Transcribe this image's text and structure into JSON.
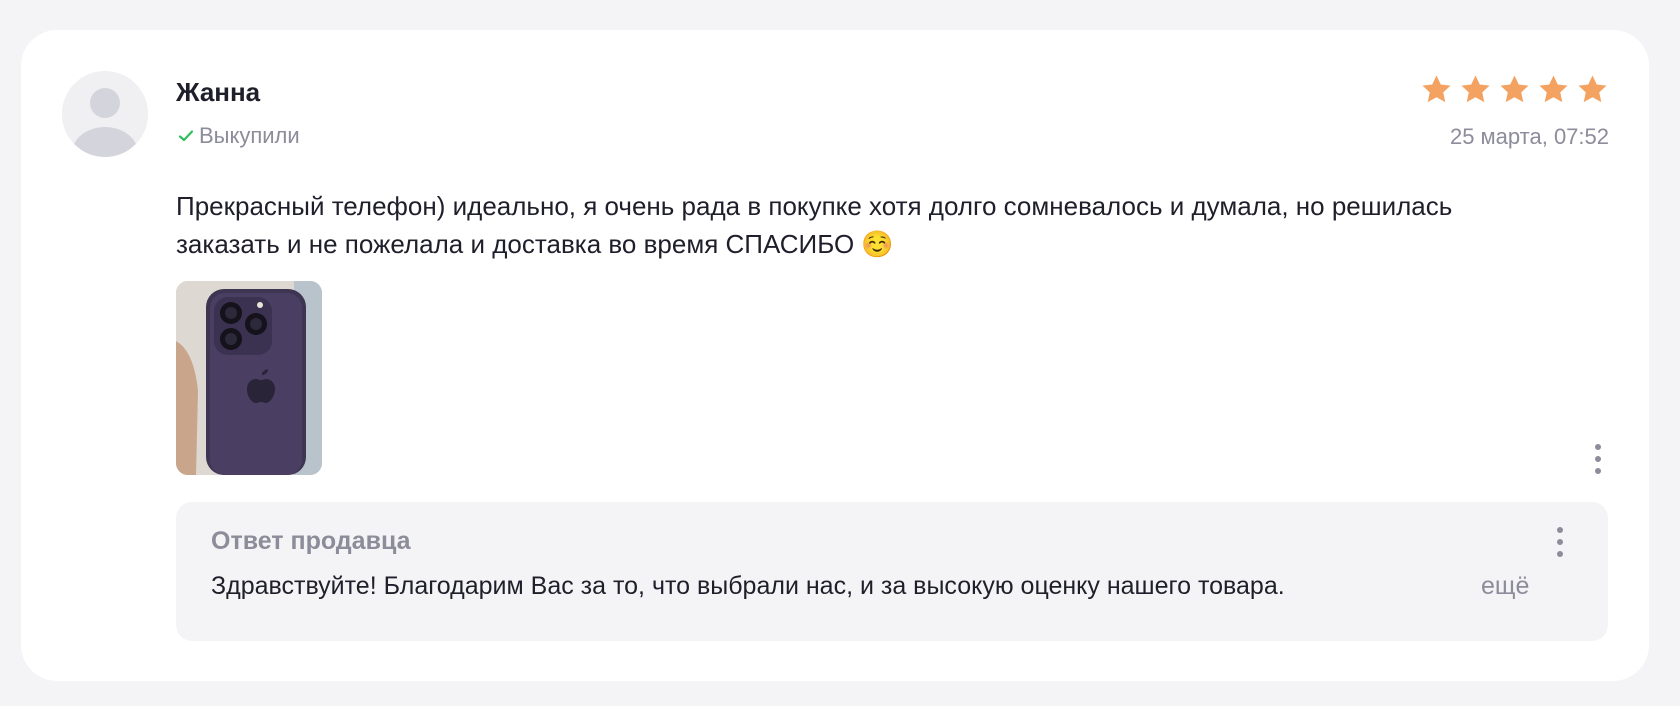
{
  "review": {
    "author": "Жанна",
    "purchase_status": "Выкупили",
    "rating": 5,
    "rating_max": 5,
    "date": "25 марта, 07:52",
    "text": "Прекрасный телефон) идеально, я очень рада в покупке хотя долго сомневалось и думала, но решилась заказать и не пожелала и доставка во время СПАСИБО ☺️",
    "photos": [
      "phone-photo"
    ],
    "icons": {
      "avatar": "user-avatar-icon",
      "check": "check-icon",
      "star": "star-icon",
      "more": "more-vertical-icon"
    },
    "colors": {
      "star": "#f3a261",
      "check": "#2fbd5e",
      "muted": "#8c8c9a",
      "text": "#1f1f2b"
    }
  },
  "seller_reply": {
    "title": "Ответ продавца",
    "text": "Здравствуйте! Благодарим Вас за то, что выбрали нас, и за высокую оценку нашего товара.",
    "more_label": "ещё"
  }
}
